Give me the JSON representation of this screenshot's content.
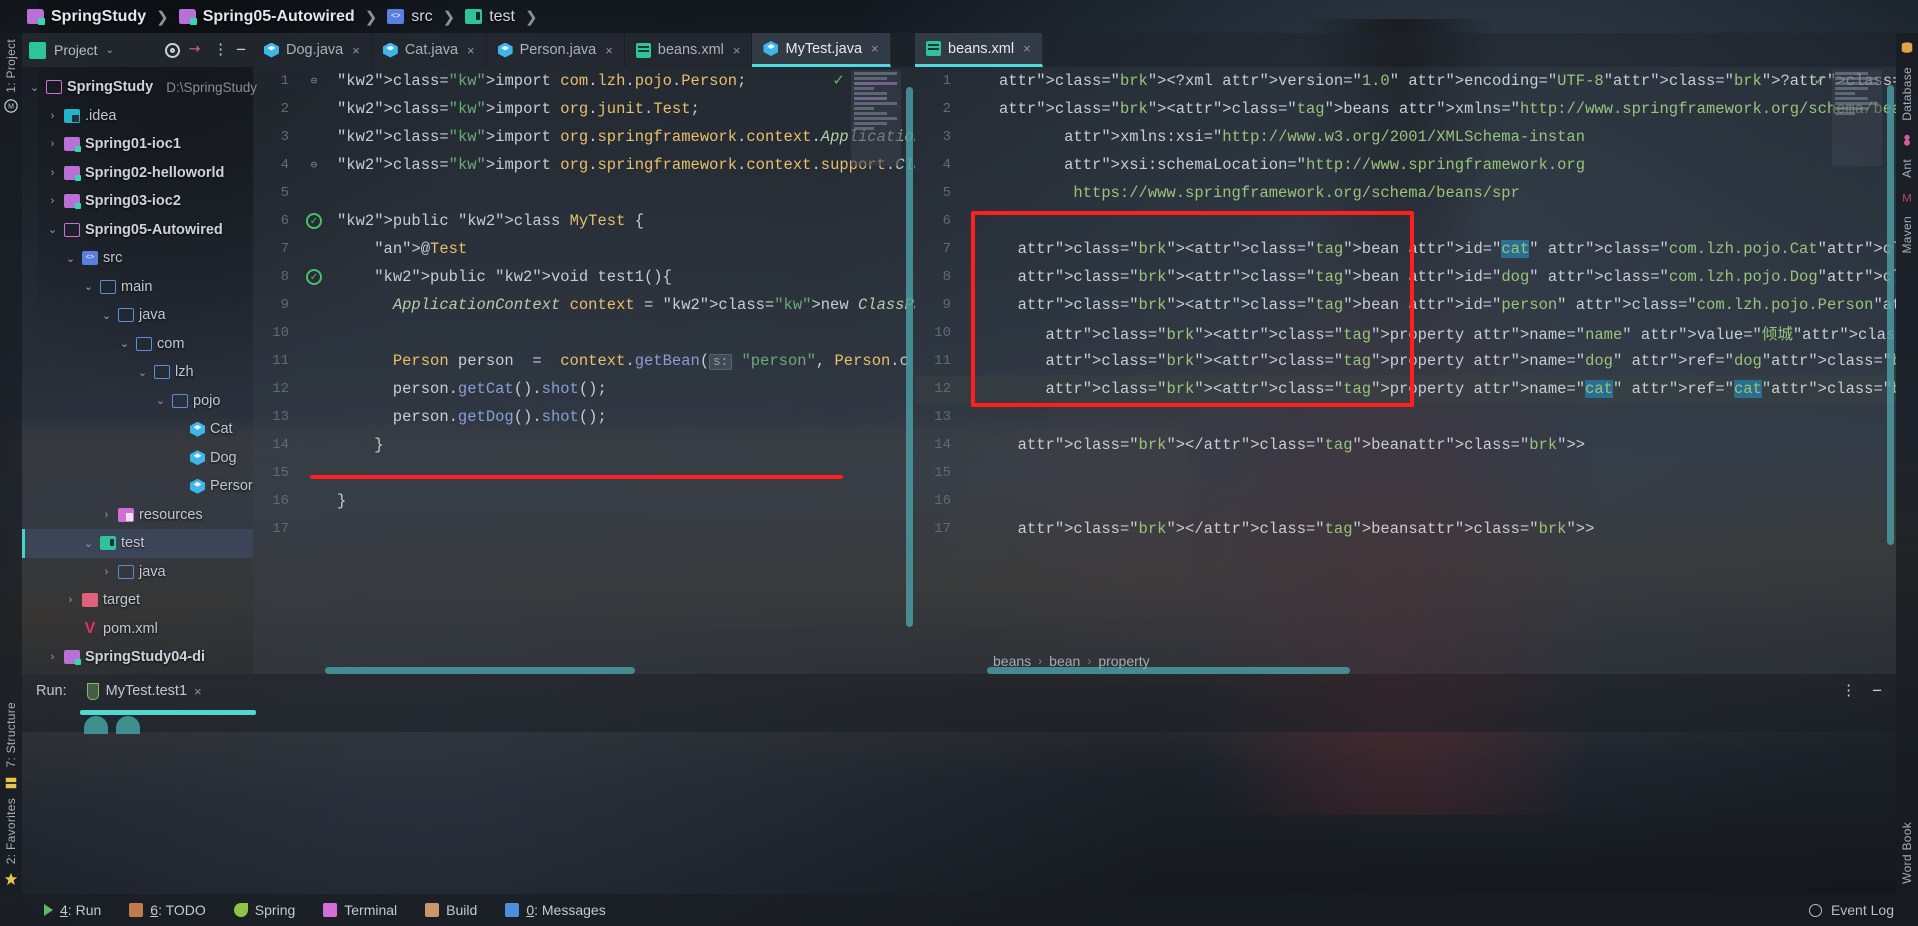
{
  "breadcrumb": {
    "items": [
      {
        "label": "SpringStudy",
        "icon": "module-folder-icon",
        "bold": true
      },
      {
        "label": "Spring05-Autowired",
        "icon": "module-folder-icon",
        "bold": true
      },
      {
        "label": "src",
        "icon": "source-root-icon",
        "bold": false
      },
      {
        "label": "test",
        "icon": "test-root-icon",
        "bold": false
      }
    ],
    "separator": "❯"
  },
  "left_rail": {
    "project_label": "1: Project",
    "structure_label": "7: Structure",
    "favorites_label": "2: Favorites"
  },
  "right_rail": {
    "database_label": "Database",
    "ant_label": "Ant",
    "maven_label": "Maven",
    "word_book_label": "Word Book"
  },
  "project_panel": {
    "title": "Project",
    "chevron": "⌄",
    "icons": [
      "folder-icon",
      "locate-icon",
      "collapse-all-icon",
      "options-icon",
      "hide-icon"
    ],
    "tree": [
      {
        "depth": 0,
        "arrow": "⌄",
        "icon": "folder-icon",
        "label": "SpringStudy",
        "bold": true,
        "path": "D:\\SpringStudy",
        "selected": false
      },
      {
        "depth": 1,
        "arrow": "›",
        "icon": "idea-folder-icon",
        "label": ".idea",
        "bold": false,
        "path": "",
        "selected": false
      },
      {
        "depth": 1,
        "arrow": "›",
        "icon": "module-folder-icon",
        "label": "Spring01-ioc1",
        "bold": true,
        "path": "",
        "selected": false
      },
      {
        "depth": 1,
        "arrow": "›",
        "icon": "module-folder-icon",
        "label": "Spring02-helloworld",
        "bold": true,
        "path": "",
        "selected": false
      },
      {
        "depth": 1,
        "arrow": "›",
        "icon": "module-folder-icon",
        "label": "Spring03-ioc2",
        "bold": true,
        "path": "",
        "selected": false
      },
      {
        "depth": 1,
        "arrow": "⌄",
        "icon": "folder-icon",
        "label": "Spring05-Autowired",
        "bold": true,
        "path": "",
        "selected": false
      },
      {
        "depth": 2,
        "arrow": "⌄",
        "icon": "source-root-icon",
        "label": "src",
        "bold": false,
        "path": "",
        "selected": false
      },
      {
        "depth": 3,
        "arrow": "⌄",
        "icon": "folder-blue-icon",
        "label": "main",
        "bold": false,
        "path": "",
        "selected": false
      },
      {
        "depth": 4,
        "arrow": "⌄",
        "icon": "folder-blue-icon",
        "label": "java",
        "bold": false,
        "path": "",
        "selected": false
      },
      {
        "depth": 5,
        "arrow": "⌄",
        "icon": "folder-blue-icon",
        "label": "com",
        "bold": false,
        "path": "",
        "selected": false
      },
      {
        "depth": 6,
        "arrow": "⌄",
        "icon": "folder-blue-icon",
        "label": "lzh",
        "bold": false,
        "path": "",
        "selected": false
      },
      {
        "depth": 7,
        "arrow": "⌄",
        "icon": "folder-blue-icon",
        "label": "pojo",
        "bold": false,
        "path": "",
        "selected": false
      },
      {
        "depth": 8,
        "arrow": "",
        "icon": "java-class-icon",
        "label": "Cat",
        "bold": false,
        "path": "",
        "selected": false
      },
      {
        "depth": 8,
        "arrow": "",
        "icon": "java-class-icon",
        "label": "Dog",
        "bold": false,
        "path": "",
        "selected": false
      },
      {
        "depth": 8,
        "arrow": "",
        "icon": "java-class-icon",
        "label": "Persor",
        "bold": false,
        "path": "",
        "selected": false
      },
      {
        "depth": 4,
        "arrow": "›",
        "icon": "resources-folder-icon",
        "label": "resources",
        "bold": false,
        "path": "",
        "selected": false
      },
      {
        "depth": 3,
        "arrow": "⌄",
        "icon": "test-root-icon",
        "label": "test",
        "bold": false,
        "path": "",
        "selected": true
      },
      {
        "depth": 4,
        "arrow": "›",
        "icon": "folder-blue-icon",
        "label": "java",
        "bold": false,
        "path": "",
        "selected": false
      },
      {
        "depth": 2,
        "arrow": "›",
        "icon": "target-folder-icon",
        "label": "target",
        "bold": false,
        "path": "",
        "selected": false
      },
      {
        "depth": 2,
        "arrow": "",
        "icon": "maven-icon",
        "label": "pom.xml",
        "bold": false,
        "path": "",
        "selected": false
      },
      {
        "depth": 1,
        "arrow": "›",
        "icon": "module-folder-icon",
        "label": "SpringStudy04-di",
        "bold": true,
        "path": "",
        "selected": false
      }
    ]
  },
  "left_editor": {
    "tabs": [
      {
        "label": "Dog.java",
        "icon": "java-class-icon",
        "active": false
      },
      {
        "label": "Cat.java",
        "icon": "java-class-icon",
        "active": false
      },
      {
        "label": "Person.java",
        "icon": "java-class-icon",
        "active": false
      },
      {
        "label": "beans.xml",
        "icon": "xml-file-icon",
        "active": false
      },
      {
        "label": "MyTest.java",
        "icon": "java-class-icon",
        "active": true
      }
    ],
    "close_glyph": "×",
    "lines": [
      {
        "n": "1",
        "mark": "",
        "fold": "−"
      },
      {
        "n": "2",
        "mark": "",
        "fold": ""
      },
      {
        "n": "3",
        "mark": "",
        "fold": ""
      },
      {
        "n": "4",
        "mark": "",
        "fold": "−"
      },
      {
        "n": "5",
        "mark": "",
        "fold": ""
      },
      {
        "n": "6",
        "mark": "run",
        "fold": ""
      },
      {
        "n": "7",
        "mark": "",
        "fold": ""
      },
      {
        "n": "8",
        "mark": "run",
        "fold": "−"
      },
      {
        "n": "9",
        "mark": "",
        "fold": ""
      },
      {
        "n": "10",
        "mark": "",
        "fold": ""
      },
      {
        "n": "11",
        "mark": "",
        "fold": ""
      },
      {
        "n": "12",
        "mark": "",
        "fold": ""
      },
      {
        "n": "13",
        "mark": "",
        "fold": ""
      },
      {
        "n": "14",
        "mark": "",
        "fold": ""
      },
      {
        "n": "15",
        "mark": "",
        "fold": ""
      },
      {
        "n": "16",
        "mark": "",
        "fold": ""
      },
      {
        "n": "17",
        "mark": "",
        "fold": ""
      }
    ],
    "code_text": [
      "import com.lzh.pojo.Person;",
      "import org.junit.Test;",
      "import org.springframework.context.ApplicationContext;",
      "import org.springframework.context.support.ClassPathXmlApplic",
      "",
      "public class MyTest {",
      "    @Test",
      "    public void test1(){",
      "      ApplicationContext context = new ClassPathXmlApplication",
      "",
      "      Person person  =  context.getBean( s: \"person\", Person.c",
      "      person.getCat().shot();",
      "      person.getDog().shot();",
      "    }",
      "",
      "}",
      ""
    ],
    "parameter_hint": "s:"
  },
  "right_editor": {
    "tabs": [
      {
        "label": "beans.xml",
        "icon": "xml-file-icon",
        "active": true
      }
    ],
    "close_glyph": "×",
    "lines": [
      {
        "n": "1"
      },
      {
        "n": "2"
      },
      {
        "n": "3"
      },
      {
        "n": "4"
      },
      {
        "n": "5"
      },
      {
        "n": "6"
      },
      {
        "n": "7"
      },
      {
        "n": "8"
      },
      {
        "n": "9"
      },
      {
        "n": "10"
      },
      {
        "n": "11"
      },
      {
        "n": "12"
      },
      {
        "n": "13"
      },
      {
        "n": "14"
      },
      {
        "n": "15"
      },
      {
        "n": "16"
      },
      {
        "n": "17"
      }
    ],
    "code_text": [
      "<?xml version=\"1.0\" encoding=\"UTF-8\"?>",
      "<beans xmlns=\"http://www.springframework.org/schema/bean",
      "       xmlns:xsi=\"http://www.w3.org/2001/XMLSchema-instan",
      "       xsi:schemaLocation=\"http://www.springframework.org",
      "        https://www.springframework.org/schema/beans/spr",
      "",
      "  <bean id=\"cat\" class=\"com.lzh.pojo.Cat\"/>",
      "  <bean id=\"dog\" class=\"com.lzh.pojo.Dog\"/>",
      "  <bean id=\"person\" class=\"com.lzh.pojo.Person\">",
      "     <property name=\"name\" value=\"倾城\"/>",
      "     <property name=\"dog\" ref=\"dog\"/>",
      "     <property name=\"cat\" ref=\"cat\"/>",
      "",
      "  </bean>",
      "",
      "",
      "  </beans>"
    ],
    "selected_token": "cat",
    "breadcrumb": [
      "beans",
      "bean",
      "property"
    ],
    "breadcrumb_sep": "›"
  },
  "run_panel": {
    "label": "Run:",
    "tab_name": "MyTest.test1",
    "close_glyph": "×",
    "options_glyph": "⋮",
    "hide_glyph": "−"
  },
  "status_bar": {
    "items": [
      {
        "num": "4",
        "label": "Run",
        "icon": "run-icon"
      },
      {
        "num": "6",
        "label": "TODO",
        "icon": "todo-icon"
      },
      {
        "num": "",
        "label": "Spring",
        "icon": "spring-icon"
      },
      {
        "num": "",
        "label": "Terminal",
        "icon": "terminal-icon"
      },
      {
        "num": "",
        "label": "Build",
        "icon": "build-icon"
      },
      {
        "num": "0",
        "label": "Messages",
        "icon": "messages-icon"
      }
    ],
    "event_log": "Event Log",
    "event_log_icon": "bell-icon"
  },
  "colors": {
    "accent": "#4fd9e0",
    "highlight_red": "#ff1f1f",
    "selection_blue": "#2a6e92",
    "run_green": "#4bbf6a"
  }
}
